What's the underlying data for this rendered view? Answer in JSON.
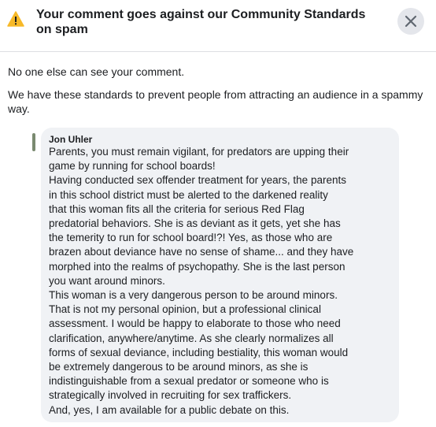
{
  "dialog": {
    "title": "Your comment goes against our Community Standards on spam",
    "icons": {
      "warning": "warning-triangle-icon",
      "close": "close-x-icon"
    },
    "colors": {
      "warning": "#f7b928",
      "close_bg": "#e4e6eb",
      "bubble_bg": "#f0f2f5"
    }
  },
  "body": {
    "paragraph1": "No one else can see your comment.",
    "paragraph2": "We have these standards to prevent people from attracting an audience in a spammy way."
  },
  "comment": {
    "author": "Jon Uhler",
    "lines": [
      "Parents, you must remain vigilant, for predators are upping their",
      "game by running for school boards!",
      "Having conducted sex offender treatment for years, the parents",
      "in this school district must be alerted to the darkened reality",
      "that this woman fits all the criteria for serious Red Flag",
      "predatorial behaviors. She is as deviant as it gets, yet she has",
      "the temerity to run for school board!?! Yes, as those who are",
      "brazen about deviance have no sense of shame... and they have",
      "morphed into the realms of psychopathy. She is the last person",
      "you want around minors.",
      "This woman is a very dangerous person to be around minors.",
      "That is not my personal opinion, but a professional clinical",
      "assessment. I would be happy to elaborate to those who need",
      "clarification, anywhere/anytime. As she clearly normalizes all",
      "forms of sexual deviance, including bestiality, this woman would",
      "be extremely dangerous to be around minors, as she is",
      "indistinguishable from a sexual predator or someone who is",
      "strategically involved in recruiting for sex traffickers.",
      "And, yes, I am available for a public debate on this."
    ]
  }
}
